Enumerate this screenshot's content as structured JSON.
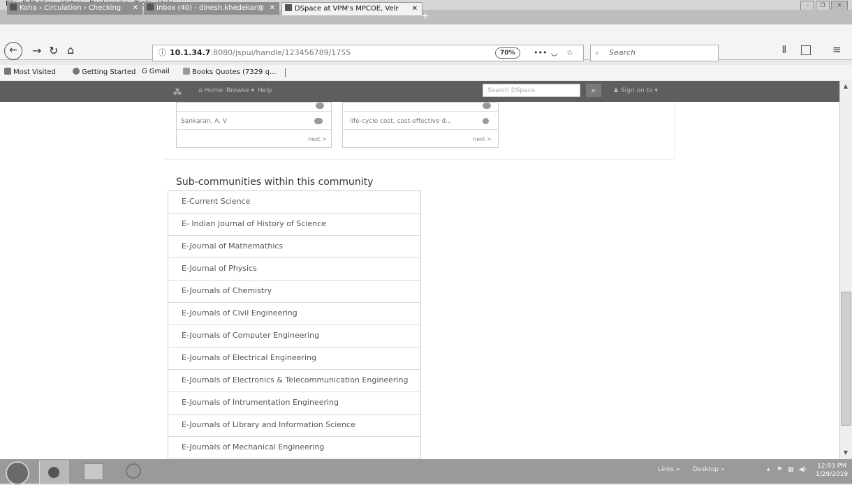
{
  "menubar": {
    "items": [
      "File",
      "Edit",
      "View",
      "History",
      "Bookmarks",
      "Tools",
      "Help"
    ]
  },
  "tabs": [
    {
      "label": "Koha › Circulation › Checking",
      "active": false
    },
    {
      "label": "Inbox (40) - dinesh.khedekar@",
      "active": false
    },
    {
      "label": "DSpace at VPM's MPCOE, Velr",
      "active": true
    }
  ],
  "navbar": {
    "url_host": "10.1.34.7",
    "url_rest": ":8080/jspui/handle/123456789/1755",
    "zoom": "70%",
    "search_placeholder": "Search"
  },
  "bookmarks": [
    {
      "label": "Most Visited",
      "icon": "gear-icon"
    },
    {
      "label": "Getting Started",
      "icon": "firefox-icon"
    },
    {
      "label": "Gmail",
      "icon": "google-icon"
    },
    {
      "label": "Books Quotes (7329 q...",
      "icon": "goodreads-icon"
    }
  ],
  "dspace": {
    "nav": {
      "home": "Home",
      "browse": "Browse",
      "help": "Help",
      "signon": "Sign on to"
    },
    "search_placeholder": "Search DSpace",
    "panels": [
      {
        "author": "Sankaran, A. V",
        "next": "next >"
      },
      {
        "subject": "life-cycle cost, cost-effective d...",
        "next": "next >"
      }
    ],
    "subcommunities_heading": "Sub-communities within this community",
    "subcommunities": [
      "E-Current Science",
      "E- Indian Journal of History of Science",
      "E-Journal of Mathemathics",
      "E-Journal of Physics",
      "E-Journals of Chemistry",
      "E-Journals of Civil Engineering",
      "E-Journals of Computer Engineering",
      "E-Journals of Electrical Engineering",
      "E-Journals of Electronics & Telecommunication Engineering",
      "E-Journals of Intrumentation Engineering",
      "E-Journals of Library and Information Science",
      "E-Journals of Mechanical Engineering"
    ]
  },
  "taskbar": {
    "links": "Links",
    "desktop": "Desktop",
    "time": "12:03 PM",
    "date": "1/29/2019"
  }
}
